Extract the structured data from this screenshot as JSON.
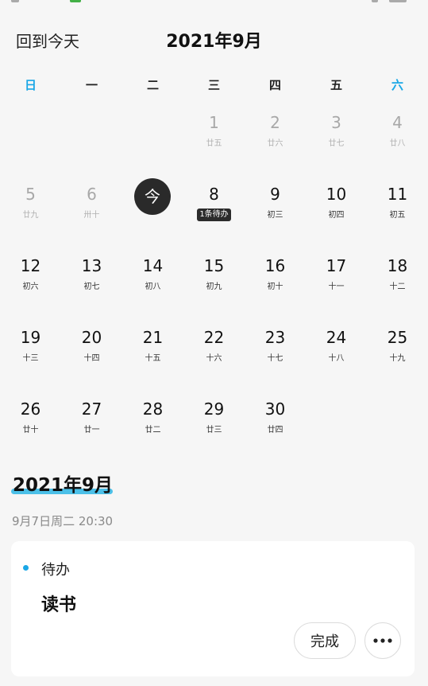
{
  "header": {
    "back_today": "回到今天",
    "month_title": "2021年9月"
  },
  "weekdays": [
    "日",
    "一",
    "二",
    "三",
    "四",
    "五",
    "六"
  ],
  "calendar": {
    "rows": [
      [
        {},
        {},
        {},
        {
          "day": "1",
          "lunar": "廿五",
          "muted": true
        },
        {
          "day": "2",
          "lunar": "廿六",
          "muted": true
        },
        {
          "day": "3",
          "lunar": "廿七",
          "muted": true
        },
        {
          "day": "4",
          "lunar": "廿八",
          "muted": true
        }
      ],
      [
        {
          "day": "5",
          "lunar": "廿九",
          "muted": true
        },
        {
          "day": "6",
          "lunar": "卅十",
          "muted": true
        },
        {
          "today": true,
          "label": "今"
        },
        {
          "day": "8",
          "badge": "1条待办"
        },
        {
          "day": "9",
          "lunar": "初三"
        },
        {
          "day": "10",
          "lunar": "初四"
        },
        {
          "day": "11",
          "lunar": "初五"
        }
      ],
      [
        {
          "day": "12",
          "lunar": "初六"
        },
        {
          "day": "13",
          "lunar": "初七"
        },
        {
          "day": "14",
          "lunar": "初八"
        },
        {
          "day": "15",
          "lunar": "初九"
        },
        {
          "day": "16",
          "lunar": "初十"
        },
        {
          "day": "17",
          "lunar": "十一"
        },
        {
          "day": "18",
          "lunar": "十二"
        }
      ],
      [
        {
          "day": "19",
          "lunar": "十三"
        },
        {
          "day": "20",
          "lunar": "十四"
        },
        {
          "day": "21",
          "lunar": "十五"
        },
        {
          "day": "22",
          "lunar": "十六"
        },
        {
          "day": "23",
          "lunar": "十七"
        },
        {
          "day": "24",
          "lunar": "十八"
        },
        {
          "day": "25",
          "lunar": "十九"
        }
      ],
      [
        {
          "day": "26",
          "lunar": "廿十"
        },
        {
          "day": "27",
          "lunar": "廿一"
        },
        {
          "day": "28",
          "lunar": "廿二"
        },
        {
          "day": "29",
          "lunar": "廿三"
        },
        {
          "day": "30",
          "lunar": "廿四"
        },
        {},
        {}
      ]
    ]
  },
  "agenda": {
    "section_title": "2021年9月",
    "datetime": "9月7日周二 20:30",
    "card": {
      "type_label": "待办",
      "title": "读书",
      "done_label": "完成"
    }
  },
  "colors": {
    "accent": "#1aa7e6",
    "underline": "#4cc0e8",
    "today_bg": "#2a2a2a"
  }
}
